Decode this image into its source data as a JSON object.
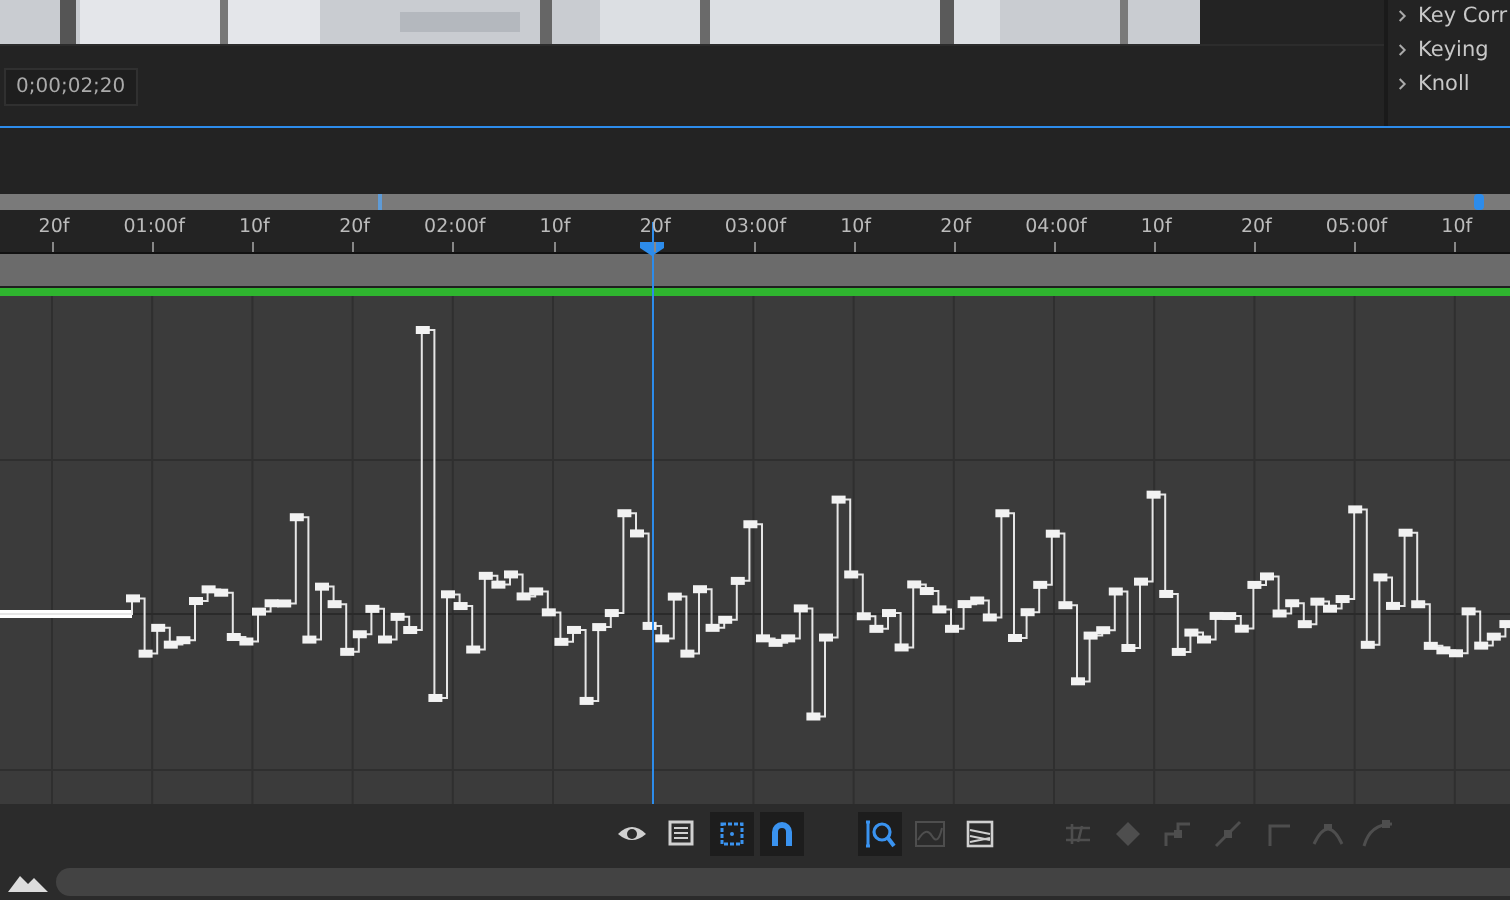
{
  "effects_panel": {
    "items": [
      {
        "label": "Key Corr"
      },
      {
        "label": "Keying"
      },
      {
        "label": "Knoll"
      }
    ]
  },
  "timecode": "0;00;02;20",
  "ruler": {
    "labels": [
      "20f",
      "01:00f",
      "10f",
      "20f",
      "02:00f",
      "10f",
      "20f",
      "03:00f",
      "10f",
      "20f",
      "04:00f",
      "10f",
      "20f",
      "05:00f",
      "10f"
    ],
    "playhead": {
      "level": 0.432
    }
  },
  "toolbar": [
    {
      "kind": "eye",
      "active": false,
      "disabled": false
    },
    {
      "kind": "list",
      "active": false,
      "disabled": false
    },
    {
      "kind": "frame",
      "active": true,
      "disabled": false
    },
    {
      "kind": "snap",
      "active": true,
      "disabled": false
    },
    {
      "kind": "zoom",
      "active": true,
      "disabled": false
    },
    {
      "kind": "graph",
      "active": false,
      "disabled": true
    },
    {
      "kind": "lines",
      "active": false,
      "disabled": false
    },
    {
      "kind": "align",
      "active": false,
      "disabled": true
    },
    {
      "kind": "diamond",
      "active": false,
      "disabled": true
    },
    {
      "kind": "hold",
      "active": false,
      "disabled": true
    },
    {
      "kind": "linear",
      "active": false,
      "disabled": true
    },
    {
      "kind": "corner",
      "active": false,
      "disabled": true
    },
    {
      "kind": "ease",
      "active": false,
      "disabled": true
    },
    {
      "kind": "easeout",
      "active": false,
      "disabled": true
    }
  ]
}
